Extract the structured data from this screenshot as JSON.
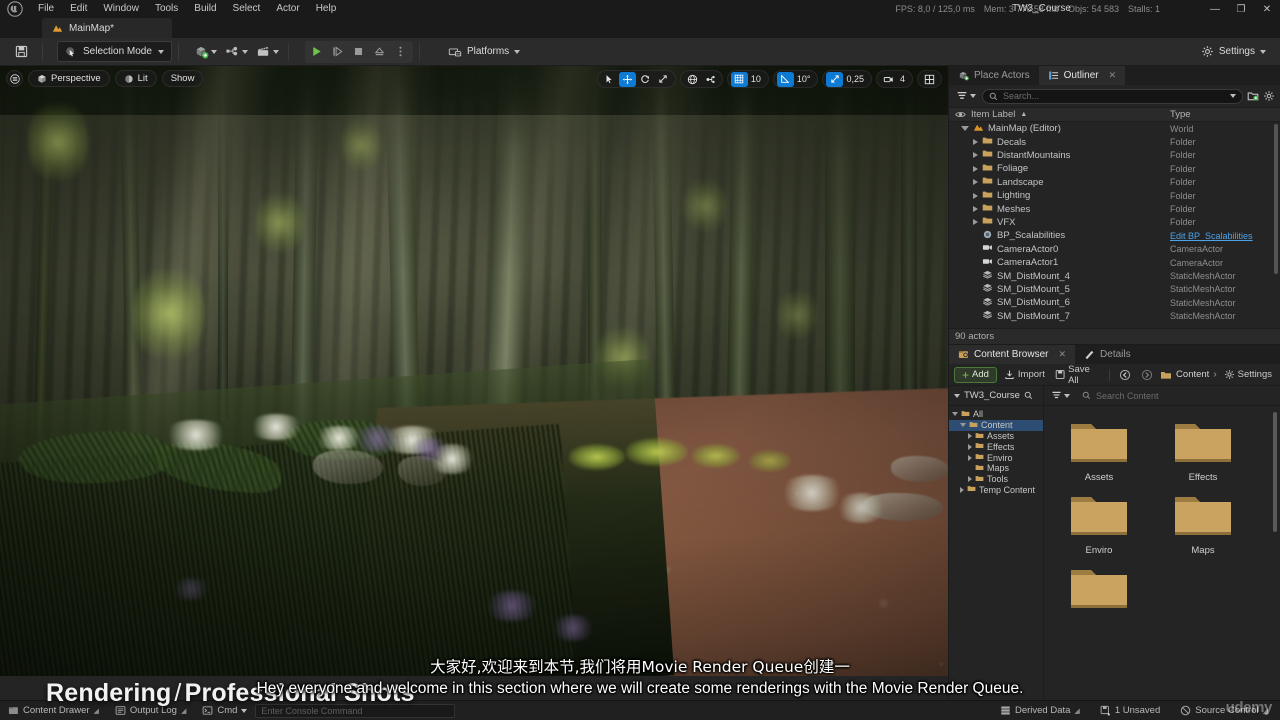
{
  "titlebar": {
    "menus": [
      "File",
      "Edit",
      "Window",
      "Tools",
      "Build",
      "Select",
      "Actor",
      "Help"
    ],
    "stats": [
      "FPS: 8,0  / 125,0 ms",
      "Mem: 3 776,58 mb",
      "Objs: 54 583",
      "Stalls: 1"
    ],
    "project": "TW3_Course",
    "minimize": "—",
    "maximize": "❐",
    "close": "✕"
  },
  "maptab": {
    "label": "MainMap*",
    "icon": "map-icon"
  },
  "toolbar": {
    "save_icon": "save-icon",
    "mode_label": "Selection Mode",
    "mode_icon": "selection-mode-icon",
    "add_icon": "add-actor-icon",
    "blueprint_icon": "blueprint-icon",
    "cinematics_icon": "cinematics-icon",
    "play_icon": "play-icon",
    "skip_icon": "skip-icon",
    "stop_icon": "stop-icon",
    "eject_icon": "eject-icon",
    "more_icon": "more-options-icon",
    "platforms_label": "Platforms",
    "platforms_icon": "platforms-icon",
    "settings_label": "Settings",
    "settings_icon": "gear-icon"
  },
  "viewport": {
    "menu_icon": "viewport-menu-icon",
    "perspective": "Perspective",
    "lit": "Lit",
    "show": "Show",
    "grid_value": "10",
    "angle_value": "10°",
    "scale_value": "0,25",
    "camera_value": "4",
    "tools": [
      "select-tool",
      "move-tool",
      "rotate-tool",
      "scale-tool"
    ],
    "active_tool": "move-tool",
    "accent": "#0d7ad4"
  },
  "outliner": {
    "tabs": [
      {
        "label": "Place Actors",
        "icon": "place-actors-icon",
        "active": false,
        "closable": false
      },
      {
        "label": "Outliner",
        "icon": "outliner-icon",
        "active": true,
        "closable": true
      }
    ],
    "filter_icon": "filter-icon",
    "search_placeholder": "Search...",
    "search_icon": "search-icon",
    "add_icon": "add-folder-icon",
    "settings_icon": "gear-icon",
    "columns": {
      "label": "Item Label",
      "type": "Type",
      "sort": "▲",
      "eye": "eye-icon"
    },
    "rows": [
      {
        "name": "MainMap (Editor)",
        "type": "World",
        "indent": 0,
        "icon": "map-icon",
        "arrow": "open",
        "link": false
      },
      {
        "name": "Decals",
        "type": "Folder",
        "indent": 1,
        "icon": "folder-icon",
        "arrow": "closed",
        "link": false
      },
      {
        "name": "DistantMountains",
        "type": "Folder",
        "indent": 1,
        "icon": "folder-icon",
        "arrow": "closed",
        "link": false
      },
      {
        "name": "Foliage",
        "type": "Folder",
        "indent": 1,
        "icon": "folder-icon",
        "arrow": "closed",
        "link": false
      },
      {
        "name": "Landscape",
        "type": "Folder",
        "indent": 1,
        "icon": "folder-icon",
        "arrow": "closed",
        "link": false
      },
      {
        "name": "Lighting",
        "type": "Folder",
        "indent": 1,
        "icon": "folder-icon",
        "arrow": "closed",
        "link": false
      },
      {
        "name": "Meshes",
        "type": "Folder",
        "indent": 1,
        "icon": "folder-icon",
        "arrow": "closed",
        "link": false
      },
      {
        "name": "VFX",
        "type": "Folder",
        "indent": 1,
        "icon": "folder-icon",
        "arrow": "closed",
        "link": false
      },
      {
        "name": "BP_Scalabilities",
        "type": "Edit BP_Scalabilities",
        "indent": 1,
        "icon": "blueprint-icon",
        "arrow": "none",
        "link": true
      },
      {
        "name": "CameraActor0",
        "type": "CameraActor",
        "indent": 1,
        "icon": "camera-icon",
        "arrow": "none",
        "link": false
      },
      {
        "name": "CameraActor1",
        "type": "CameraActor",
        "indent": 1,
        "icon": "camera-icon",
        "arrow": "none",
        "link": false
      },
      {
        "name": "SM_DistMount_4",
        "type": "StaticMeshActor",
        "indent": 1,
        "icon": "mesh-icon",
        "arrow": "none",
        "link": false
      },
      {
        "name": "SM_DistMount_5",
        "type": "StaticMeshActor",
        "indent": 1,
        "icon": "mesh-icon",
        "arrow": "none",
        "link": false
      },
      {
        "name": "SM_DistMount_6",
        "type": "StaticMeshActor",
        "indent": 1,
        "icon": "mesh-icon",
        "arrow": "none",
        "link": false
      },
      {
        "name": "SM_DistMount_7",
        "type": "StaticMeshActor",
        "indent": 1,
        "icon": "mesh-icon",
        "arrow": "none",
        "link": false
      }
    ],
    "footer": "90 actors"
  },
  "content_browser": {
    "tabs": [
      {
        "label": "Content Browser",
        "icon": "content-browser-icon",
        "active": true,
        "closable": true
      },
      {
        "label": "Details",
        "icon": "details-icon",
        "active": false,
        "closable": false
      }
    ],
    "add_label": "Add",
    "import_label": "Import",
    "save_all_label": "Save All",
    "path_label": "Content",
    "settings_label": "Settings",
    "source_label": "TW3_Course",
    "search_placeholder": "Search Content",
    "tree": [
      {
        "label": "All",
        "indent": 0,
        "arrow": "open",
        "selected": false
      },
      {
        "label": "Content",
        "indent": 1,
        "arrow": "open",
        "selected": true
      },
      {
        "label": "Assets",
        "indent": 2,
        "arrow": "closed",
        "selected": false
      },
      {
        "label": "Effects",
        "indent": 2,
        "arrow": "closed",
        "selected": false
      },
      {
        "label": "Enviro",
        "indent": 2,
        "arrow": "closed",
        "selected": false
      },
      {
        "label": "Maps",
        "indent": 2,
        "arrow": "none",
        "selected": false
      },
      {
        "label": "Tools",
        "indent": 2,
        "arrow": "closed",
        "selected": false
      },
      {
        "label": "Temp Content",
        "indent": 1,
        "arrow": "closed",
        "selected": false
      }
    ],
    "assets": [
      {
        "name": "Assets",
        "kind": "folder"
      },
      {
        "name": "Effects",
        "kind": "folder"
      },
      {
        "name": "Enviro",
        "kind": "folder"
      },
      {
        "name": "Maps",
        "kind": "folder"
      },
      {
        "name": "",
        "kind": "folder"
      }
    ]
  },
  "statusbar": {
    "left": [
      {
        "label": "Content Drawer",
        "icon": "drawer-icon"
      },
      {
        "label": "Output Log",
        "icon": "log-icon"
      },
      {
        "label": "Cmd",
        "icon": "cmd-icon"
      }
    ],
    "cmd_placeholder": "Enter Console Command",
    "right": [
      {
        "label": "Derived Data",
        "icon": "derived-data-icon"
      },
      {
        "label": "1 Unsaved",
        "icon": "unsaved-icon"
      },
      {
        "label": "Source Control",
        "icon": "source-control-icon"
      }
    ]
  },
  "overlay": {
    "course_title_a": "Rendering",
    "course_slash": "/",
    "course_title_b": "Professional Shots",
    "subtitle_cn": "大家好,欢迎来到本节,我们将用Movie Render Queue创建一",
    "subtitle_en": "Hey everyone and welcome in this section where we will create some renderings with the Movie Render Queue.",
    "watermark": "udemy"
  }
}
